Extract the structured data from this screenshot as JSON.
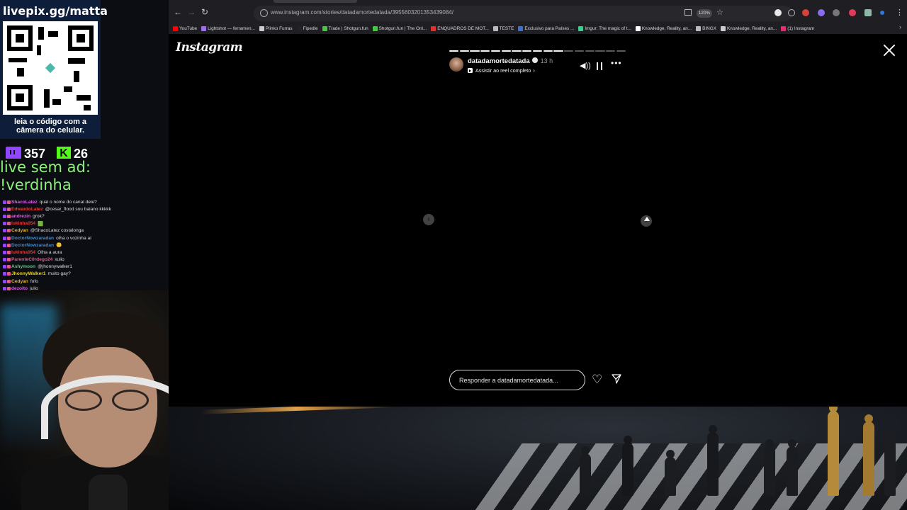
{
  "overlay": {
    "livepix_url": "livepix.gg/matta",
    "qr_caption_1": "leia o código com a",
    "qr_caption_2": "câmera do celular.",
    "twitch_count": "357",
    "kick_count": "26",
    "ad_line_1": "live sem ad:",
    "ad_line_2": "!verdinha",
    "chat": [
      {
        "user": "ShacoLatez",
        "user_color": "#e05af0",
        "message": "qual o nome do canal dele?"
      },
      {
        "user": "EdwardoLatez",
        "user_color": "#e33a3a",
        "message": "@cesar_flood sou baiano kkkkk"
      },
      {
        "user": "andrezin",
        "user_color": "#d36bd6",
        "message": "grok?"
      },
      {
        "user": "lukinha054",
        "user_color": "#e33a3a",
        "message": "🟩"
      },
      {
        "user": "Cedyan",
        "user_color": "#e6b422",
        "message": "@ShacoLatez costalonga"
      },
      {
        "user": "DoctorNowzaradan",
        "user_color": "#3b8fe0",
        "message": "olha o vozinha aí"
      },
      {
        "user": "DoctorNowzaradan",
        "user_color": "#3b8fe0",
        "message": "🙂"
      },
      {
        "user": "lukinha054",
        "user_color": "#e33a3a",
        "message": "Olha a aura"
      },
      {
        "user": "ParenteC0rdego24",
        "user_color": "#e05a8a",
        "message": "xulio"
      },
      {
        "user": "Ashymoon",
        "user_color": "#5ad07a",
        "message": "@jhonnywalker1"
      },
      {
        "user": "JhonnyWalker1",
        "user_color": "#e6d422",
        "message": "muito gay?"
      },
      {
        "user": "Cedyan",
        "user_color": "#e6b422",
        "message": "fofo"
      },
      {
        "user": "dezoito",
        "user_color": "#e05af0",
        "message": "julio"
      }
    ]
  },
  "browser": {
    "url": "www.instagram.com/stories/datadamortedatada/3955603201353439084/",
    "zoom": "120%",
    "bookmarks": [
      {
        "label": "YouTube",
        "color": "#ff0000"
      },
      {
        "label": "Lightshot — ferramen...",
        "color": "#a06cf0"
      },
      {
        "label": "Plinko Furras",
        "color": "#cccccc"
      },
      {
        "label": "Fipedle",
        "color": "#222222"
      },
      {
        "label": "Trade | Shotgun.fun",
        "color": "#3ccc3c"
      },
      {
        "label": "Shotgun.fun | The Onl...",
        "color": "#3ccc3c"
      },
      {
        "label": "ENQUADROS DE MOT...",
        "color": "#e03030"
      },
      {
        "label": "TESTE",
        "color": "#bbbbbb"
      },
      {
        "label": "Exclusivo para Países ...",
        "color": "#3a6fd8"
      },
      {
        "label": "Imgur: The magic of t...",
        "color": "#3ccc8c"
      },
      {
        "label": "Knowledge, Reality, an...",
        "color": "#ffffff"
      },
      {
        "label": "BINGX",
        "color": "#bbbbbb"
      },
      {
        "label": "Knowledge, Reality, an...",
        "color": "#cccccc"
      },
      {
        "label": "(1) Instagram",
        "color": "#e1306c"
      }
    ]
  },
  "instagram": {
    "logo": "Instagram",
    "story": {
      "username": "datadamortedatada",
      "time": "13 h",
      "reel_link": "Assistir ao reel completo",
      "segments_total": 17,
      "segments_done": 11,
      "reply_placeholder": "Responder a datadamortedatada..."
    }
  },
  "icons": {
    "back": "arrow-left-icon",
    "forward": "arrow-right-icon",
    "reload": "reload-icon",
    "close": "close-icon",
    "sound": "volume-icon",
    "pause": "pause-icon",
    "more": "more-icon",
    "heart": "heart-icon",
    "send": "send-icon",
    "prev": "chevron-left-icon",
    "next": "chevron-right-icon"
  }
}
